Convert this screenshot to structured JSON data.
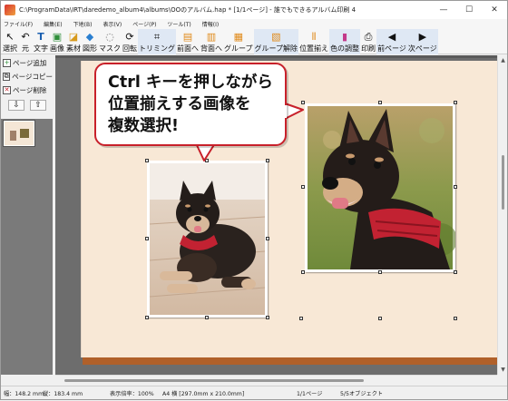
{
  "window": {
    "title": "C:\\ProgramData\\IRT\\daredemo_album4\\albums\\OOのアルバム.hap * [1/1ページ] - 誰でもできるアルバム印刷 4",
    "minimize": "—",
    "maximize": "☐",
    "close": "✕"
  },
  "menu": [
    "ファイル(F)",
    "編集(E)",
    "下地(B)",
    "表示(V)",
    "ページ(P)",
    "ツール(T)",
    "情報(I)"
  ],
  "toolbar": [
    {
      "label": "選択",
      "icon": "select-arrow-icon",
      "glyph": "↖"
    },
    {
      "label": "元",
      "icon": "undo-icon",
      "glyph": "↶"
    },
    {
      "label": "文字",
      "icon": "text-icon",
      "glyph": "T"
    },
    {
      "label": "画像",
      "icon": "image-icon",
      "glyph": "▣"
    },
    {
      "label": "素材",
      "icon": "material-icon",
      "glyph": "◪"
    },
    {
      "label": "図形",
      "icon": "shape-icon",
      "glyph": "◆"
    },
    {
      "label": "マスク",
      "icon": "mask-icon",
      "glyph": "◌"
    },
    {
      "label": "回転",
      "icon": "rotate-icon",
      "glyph": "⟳"
    },
    {
      "label": "トリミング",
      "icon": "crop-icon",
      "glyph": "⌗"
    },
    {
      "label": "前面へ",
      "icon": "bring-front-icon",
      "glyph": "▤"
    },
    {
      "label": "背面へ",
      "icon": "send-back-icon",
      "glyph": "▥"
    },
    {
      "label": "グループ",
      "icon": "group-icon",
      "glyph": "▦"
    },
    {
      "label": "グループ解除",
      "icon": "ungroup-icon",
      "glyph": "▧"
    },
    {
      "label": "位置揃え",
      "icon": "align-icon",
      "glyph": "⫴"
    },
    {
      "label": "色の調整",
      "icon": "color-adjust-icon",
      "glyph": "▮"
    },
    {
      "label": "印刷",
      "icon": "print-icon",
      "glyph": "⎙"
    },
    {
      "label": "前ページ",
      "icon": "prev-page-icon",
      "glyph": "◀"
    },
    {
      "label": "次ページ",
      "icon": "next-page-icon",
      "glyph": "▶"
    }
  ],
  "side": {
    "add_page": "ページ追加",
    "copy_page": "ページコピー",
    "delete_page": "ページ削除",
    "down": "⇩",
    "up": "⇧"
  },
  "callout": {
    "line1": "Ctrl キーを押しながら",
    "line2": "位置揃えする画像を",
    "line3": "複数選択!"
  },
  "status": {
    "width": "幅：148.2 mm,",
    "height": "縦：183.4 mm",
    "zoom": "表示倍率：100%",
    "paper": "A4 横 [297.0mm x 210.0mm]",
    "page": "1/1ページ",
    "objects": "5/5オブジェクト"
  },
  "colors": {
    "paper": "#f8e8d6",
    "paper_shadow": "#b0602a",
    "callout_border": "#c8202a",
    "workspace": "#6d6d6d"
  }
}
